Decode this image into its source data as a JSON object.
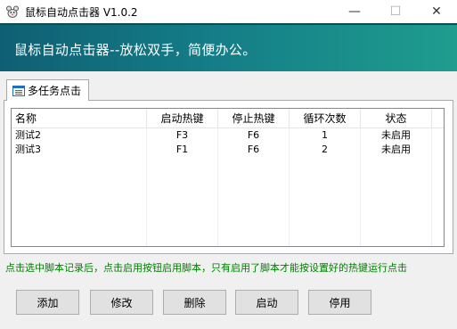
{
  "window": {
    "title": "鼠标自动点击器 V1.0.2",
    "minimize": "—",
    "maximize": "☐",
    "close": "✕"
  },
  "banner": {
    "text": "鼠标自动点击器--放松双手，简便办公。"
  },
  "tab": {
    "label": "多任务点击"
  },
  "table": {
    "columns": [
      "名称",
      "启动热键",
      "停止热键",
      "循环次数",
      "状态"
    ],
    "rows": [
      {
        "name": "测试2",
        "start_key": "F3",
        "stop_key": "F6",
        "loops": "1",
        "status": "未启用"
      },
      {
        "name": "测试3",
        "start_key": "F1",
        "stop_key": "F6",
        "loops": "2",
        "status": "未启用"
      }
    ]
  },
  "hint": "点击选中脚本记录后，点击启用按钮启用脚本，只有启用了脚本才能按设置好的热键运行点击",
  "buttons": {
    "add": "添加",
    "edit": "修改",
    "delete": "删除",
    "start": "启动",
    "stop": "停用"
  },
  "colors": {
    "banner_start": "#0f5f73",
    "banner_end": "#1f9d8e",
    "hint_text": "#008000"
  }
}
